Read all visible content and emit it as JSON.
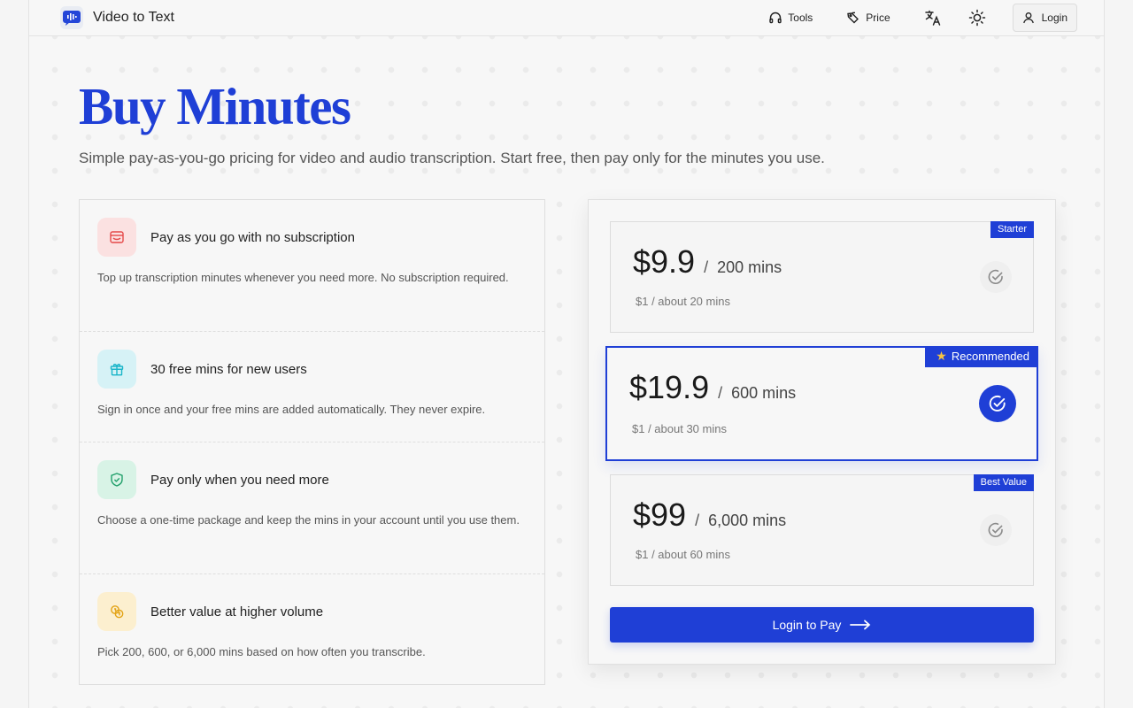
{
  "brand": {
    "name": "Video to Text"
  },
  "nav": {
    "tools": "Tools",
    "price": "Price",
    "login": "Login",
    "icons": {
      "translate": "translate-icon",
      "theme": "sun-icon",
      "user": "user-icon"
    }
  },
  "hero": {
    "title": "Buy Minutes",
    "subtitle": "Simple pay-as-you-go pricing for video and audio transcription. Start free, then pay only for the minutes you use."
  },
  "features": [
    {
      "icon": "wallet-icon",
      "color": "#e54848",
      "bg": "#fbe1e1",
      "title": "Pay as you go with no subscription",
      "desc": "Top up transcription minutes whenever you need more. No subscription required."
    },
    {
      "icon": "gift-icon",
      "color": "#19b5c9",
      "bg": "#d6f2f6",
      "title": "30 free mins for new users",
      "desc": "Sign in once and your free mins are added automatically. They never expire."
    },
    {
      "icon": "shield-check-icon",
      "color": "#22a06b",
      "bg": "#d8f3e6",
      "title": "Pay only when you need more",
      "desc": "Choose a one-time package and keep the mins in your account until you use them."
    },
    {
      "icon": "coins-icon",
      "color": "#e3a316",
      "bg": "#fcefcf",
      "title": "Better value at higher volume",
      "desc": "Pick 200, 600, or 6,000 mins based on how often you transcribe."
    }
  ],
  "plans": [
    {
      "badge": "Starter",
      "price": "$9.9",
      "slash": "/",
      "mins": "200 mins",
      "rate": "$1 / about 20 mins",
      "selected": false
    },
    {
      "badge": "Recommended",
      "price": "$19.9",
      "slash": "/",
      "mins": "600 mins",
      "rate": "$1 / about 30 mins",
      "selected": true
    },
    {
      "badge": "Best Value",
      "price": "$99",
      "slash": "/",
      "mins": "6,000 mins",
      "rate": "$1 / about 60 mins",
      "selected": false
    }
  ],
  "pay_button": {
    "label": "Login to Pay"
  },
  "colors": {
    "accent": "#1f3fd6",
    "star": "#f6c343"
  }
}
